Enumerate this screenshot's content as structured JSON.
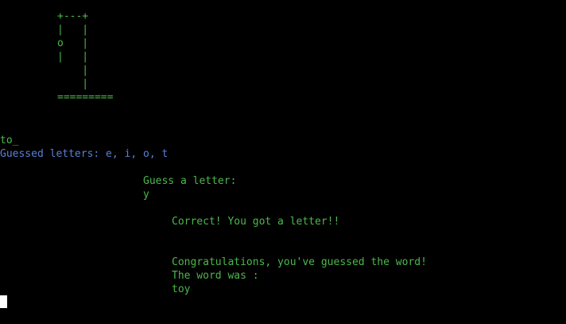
{
  "colors": {
    "background": "#000000",
    "text_green": "#4cb84c",
    "text_blue": "#5a7fd6",
    "cursor": "#ffffff"
  },
  "hangman": {
    "art_lines": [
      "+---+",
      "|   |",
      "o   |",
      "|   |",
      "    |",
      "    |",
      "========="
    ]
  },
  "game": {
    "word_progress": "to_",
    "guessed_letters": "Guessed letters: e, i, o, t",
    "prompt": "Guess a letter:",
    "input_letter": "y",
    "feedback": "Correct! You got a letter!!",
    "congrats": "Congratulations, you've guessed the word!",
    "word_reveal_label": "The word was :",
    "word": "toy"
  }
}
